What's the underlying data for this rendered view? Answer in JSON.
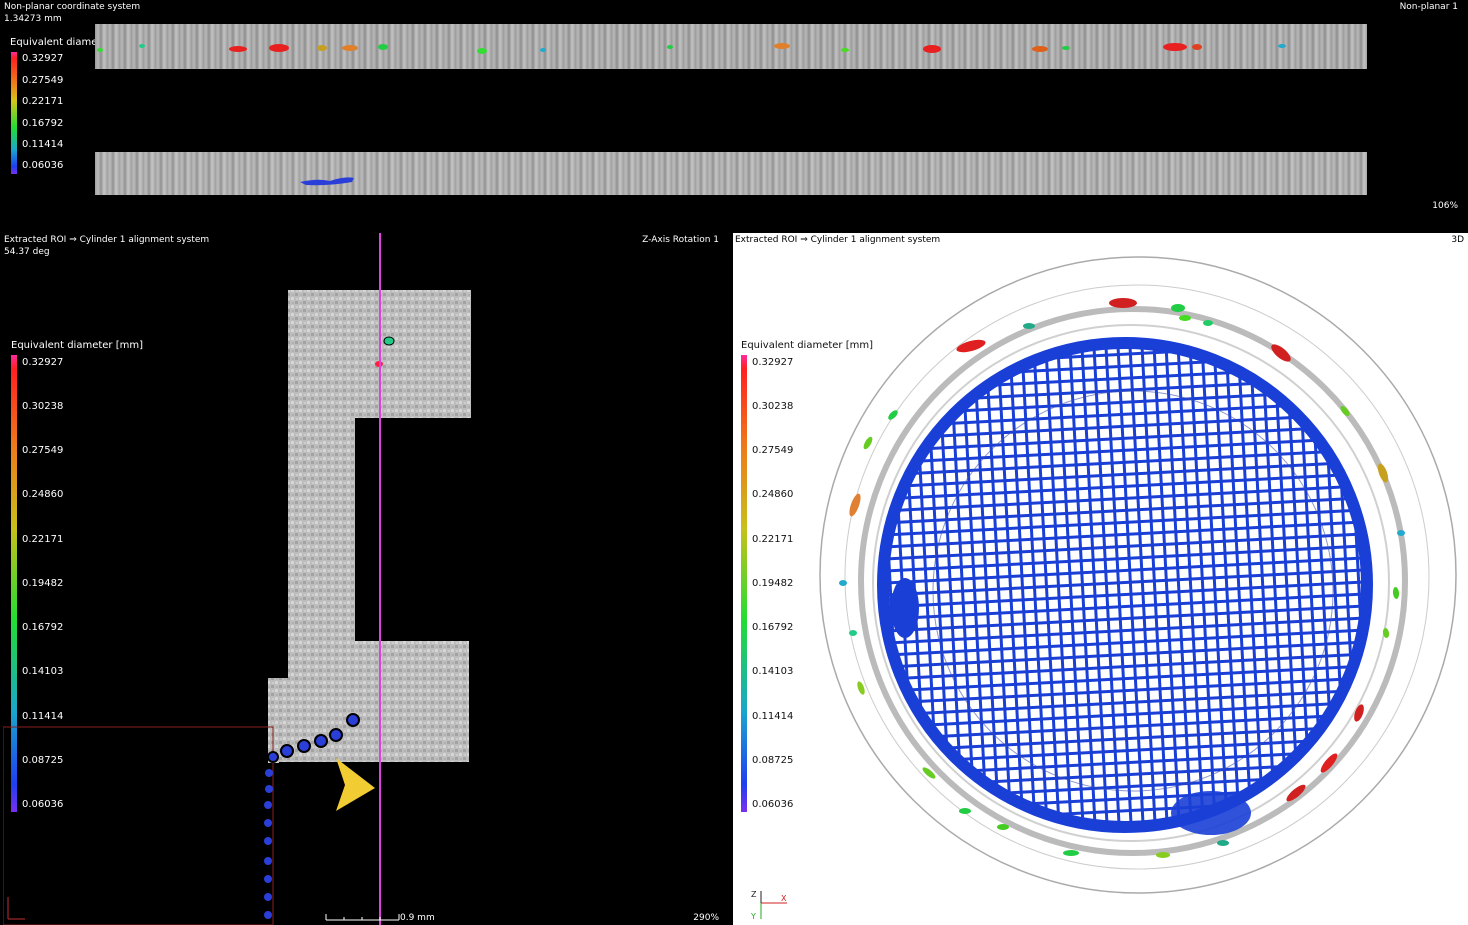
{
  "top_view": {
    "title": "Non-planar coordinate system",
    "measure": "1.34273 mm",
    "view_name": "Non-planar 1",
    "zoom": "106%",
    "legend": {
      "title": "Equivalent diameter [mm]",
      "ticks": [
        "0.32927",
        "0.27549",
        "0.22171",
        "0.16792",
        "0.11414",
        "0.06036"
      ]
    }
  },
  "slice_view": {
    "title": "Extracted ROI ⇒ Cylinder 1 alignment system",
    "angle": "54.37 deg",
    "view_name": "Z-Axis Rotation 1",
    "scale_label": "0.9 mm",
    "zoom": "290%",
    "legend": {
      "title": "Equivalent diameter [mm]",
      "ticks": [
        "0.32927",
        "0.30238",
        "0.27549",
        "0.24860",
        "0.22171",
        "0.19482",
        "0.16792",
        "0.14103",
        "0.11414",
        "0.08725",
        "0.06036"
      ]
    }
  },
  "view_3d": {
    "title": "Extracted ROI ⇒ Cylinder 1 alignment system",
    "view_name": "3D",
    "legend": {
      "title": "Equivalent diameter [mm]",
      "ticks": [
        "0.32927",
        "0.30238",
        "0.27549",
        "0.24860",
        "0.22171",
        "0.19482",
        "0.16792",
        "0.14103",
        "0.11414",
        "0.08725",
        "0.06036"
      ]
    },
    "axes": {
      "z": "Z",
      "x": "X",
      "y": "Y"
    }
  },
  "colors": {
    "slice_line": "#e040e0",
    "mesh_blue": "#1a3fd6",
    "marker_yellow": "#f2cc33",
    "scale_top": "#ff2aa0",
    "scale_bottom": "#7b2ff0"
  }
}
